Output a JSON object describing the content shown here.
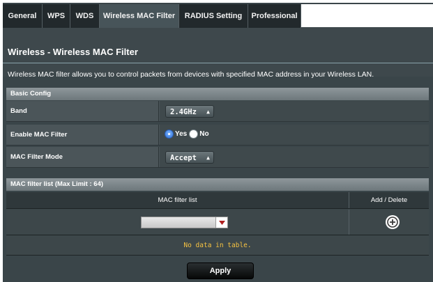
{
  "tabs": [
    {
      "label": "General"
    },
    {
      "label": "WPS"
    },
    {
      "label": "WDS"
    },
    {
      "label": "Wireless MAC Filter",
      "active": true
    },
    {
      "label": "RADIUS Setting"
    },
    {
      "label": "Professional"
    }
  ],
  "page": {
    "title": "Wireless - Wireless MAC Filter",
    "description": "Wireless MAC filter allows you to control packets from devices with specified MAC address in your Wireless LAN."
  },
  "basic_config": {
    "heading": "Basic Config",
    "band": {
      "label": "Band",
      "value": "2.4GHz"
    },
    "enable_mac_filter": {
      "label": "Enable MAC Filter",
      "yes_label": "Yes",
      "no_label": "No",
      "selected": "Yes"
    },
    "mac_filter_mode": {
      "label": "MAC Filter Mode",
      "value": "Accept"
    }
  },
  "filter_list": {
    "heading": "MAC filter list (Max Limit : 64)",
    "col_list": "MAC filter list",
    "col_action": "Add / Delete",
    "empty_text": "No data in table."
  },
  "actions": {
    "apply_label": "Apply"
  },
  "colors": {
    "accent_yellow": "#f5c242",
    "panel": "#3a4549",
    "radio_selected": "#2d6fd4"
  }
}
